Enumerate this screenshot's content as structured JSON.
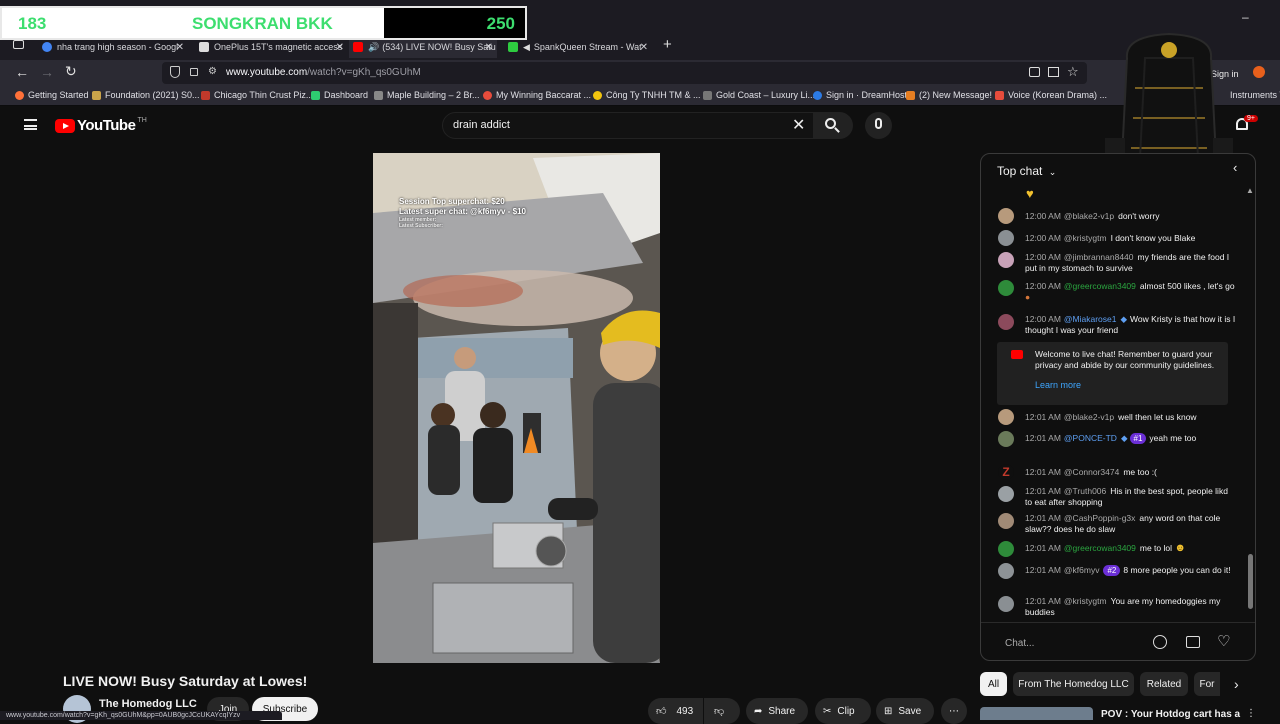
{
  "overlay": {
    "left_count": "183",
    "title": "SONGKRAN BKK",
    "right_count": "250"
  },
  "browser": {
    "tabs": [
      {
        "label": "nha trang high season - Googl",
        "favicon_color": "#4285f4"
      },
      {
        "label": "OnePlus 15T's magnetic access",
        "favicon_color": "#e0e0e0"
      },
      {
        "label": "(534) LIVE NOW! Busy Satu",
        "favicon_color": "#ff0000"
      },
      {
        "label": "SpankQueen Stream - Wat",
        "favicon_color": "#2ecc40"
      }
    ],
    "url_host": "www.youtube.com",
    "url_path": "/watch?v=gKh_qs0GUhM",
    "sign_in": "Sign in",
    "instruments": "Instruments T",
    "bookmarks": [
      "Getting Started",
      "Foundation (2021) S0...",
      "Chicago Thin Crust Piz...",
      "Dashboard",
      "Maple Building – 2 Br...",
      "My Winning Baccarat ...",
      "Công Ty TNHH TM & ...",
      "Gold Coast – Luxury Li...",
      "Sign in · DreamHost",
      "(2) New Message!",
      "Voice (Korean Drama) ..."
    ]
  },
  "youtube": {
    "logo_text": "YouTube",
    "logo_tm": "TH",
    "search_value": "drain addict",
    "notif_count": "9+"
  },
  "video": {
    "overlay_line1": "Session Top superchat: $20",
    "overlay_line2": "Latest super chat: @kf6myv - $10",
    "overlay_line3": "Latest member:",
    "overlay_line4": "Latest Subscriber:"
  },
  "chat": {
    "header": "Top chat",
    "messages": [
      {
        "time": "12:00 AM",
        "author": "@blake2-v1p",
        "author_color": "gray",
        "text": "don't worry",
        "avatar": "#b79a7c"
      },
      {
        "time": "12:00 AM",
        "author": "@kristygtm",
        "author_color": "gray",
        "text": "I don't know you Blake",
        "avatar": "#8a8f93"
      },
      {
        "time": "12:00 AM",
        "author": "@jimbrannan8440",
        "author_color": "gray",
        "text": "my friends are the food I put in my stomach to survive",
        "avatar": "#c8a2b8"
      },
      {
        "time": "12:00 AM",
        "author": "@greercowan3409",
        "author_color": "green",
        "text": "almost 500 likes , let's go",
        "avatar": "#2e8b3a"
      },
      {
        "time": "12:00 AM",
        "author": "@Miakarose1",
        "author_color": "blue",
        "text": "Wow Kristy is that how it is I thought I was your friend",
        "avatar": "#8c4a5c"
      },
      {
        "time": "12:01 AM",
        "author": "@blake2-v1p",
        "author_color": "gray",
        "text": "well then let us know",
        "avatar": "#b79a7c"
      },
      {
        "time": "12:01 AM",
        "author": "@PONCE-TD",
        "author_color": "blue",
        "badge": "#1",
        "text": "yeah me too",
        "avatar": "#6a7a5a"
      },
      {
        "time": "12:01 AM",
        "author": "@Connor3474",
        "author_color": "gray",
        "text": "me too :(",
        "avatar": "#c0392b"
      },
      {
        "time": "12:01 AM",
        "author": "@Truth006",
        "author_color": "gray",
        "text": "His in the best spot, people likd to eat after shopping",
        "avatar": "#9aa0a4"
      },
      {
        "time": "12:01 AM",
        "author": "@CashPoppin-g3x",
        "author_color": "gray",
        "text": "any word on that cole slaw?? does he do slaw",
        "avatar": "#a08a76"
      },
      {
        "time": "12:01 AM",
        "author": "@greercowan3409",
        "author_color": "green",
        "text": "me to lol",
        "avatar": "#2e8b3a"
      },
      {
        "time": "12:01 AM",
        "author": "@kf6myv",
        "author_color": "gray",
        "badge": "#2",
        "text": "8 more people you can do it!",
        "avatar": "#8d9296"
      },
      {
        "time": "12:01 AM",
        "author": "@kristygtm",
        "author_color": "gray",
        "text": "You are my homedoggies my buddies",
        "avatar": "#8a8f93"
      }
    ],
    "welcome_text": "Welcome to live chat! Remember to guard your privacy and abide by our community guidelines.",
    "learn_more": "Learn more",
    "input_placeholder": "Chat..."
  },
  "below_video": {
    "title": "LIVE NOW! Busy Saturday at Lowes!",
    "channel": "The Homedog LLC",
    "join": "Join",
    "subscribe": "Subscribe",
    "likes": "493",
    "share": "Share",
    "clip": "Clip",
    "save": "Save"
  },
  "related": {
    "chips": [
      "All",
      "From The Homedog LLC",
      "Related",
      "For"
    ],
    "first_title": "POV : Your Hotdog cart has a"
  },
  "statusbar": "www.youtube.com/watch?v=gKh_qs0GUhM&pp=0AUB0gcJCcUKAYcqIYzv"
}
